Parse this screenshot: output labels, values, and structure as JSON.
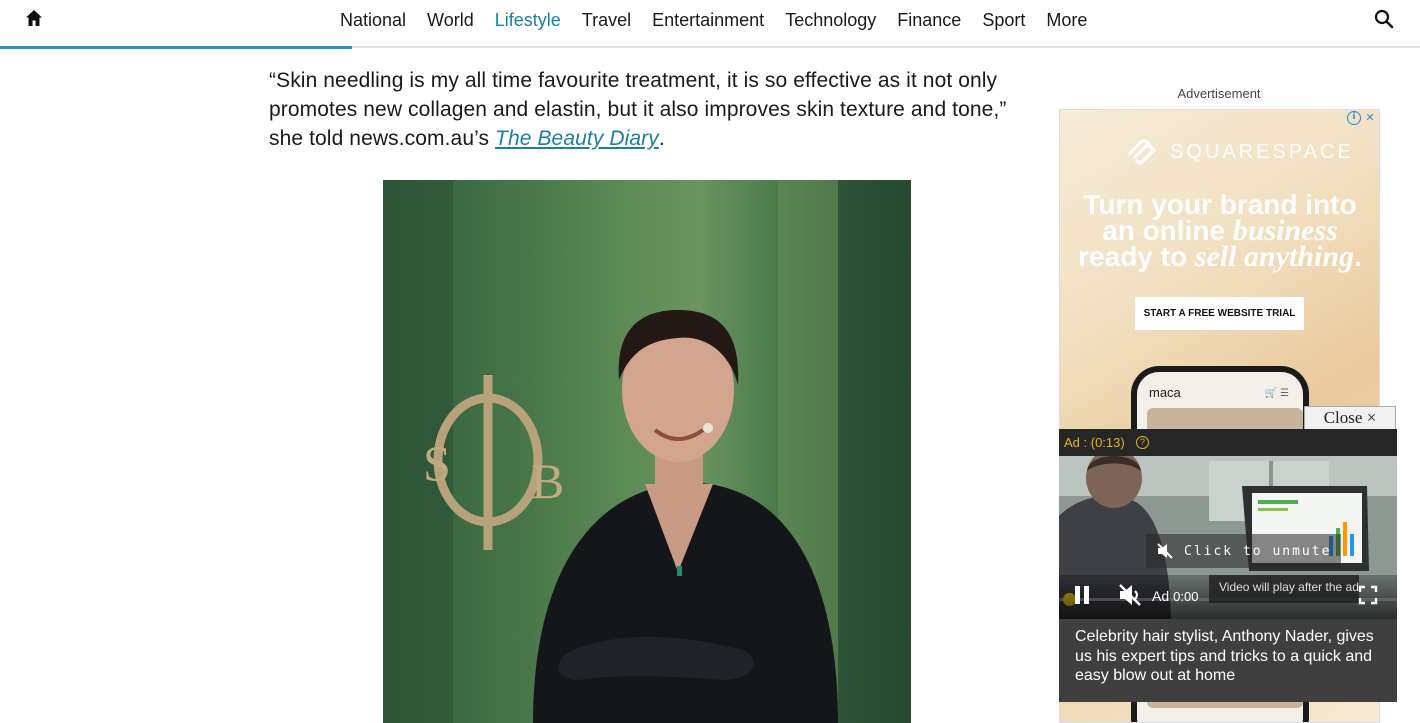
{
  "nav": {
    "items": [
      "National",
      "World",
      "Lifestyle",
      "Travel",
      "Entertainment",
      "Technology",
      "Finance",
      "Sport",
      "More"
    ],
    "active": "Lifestyle",
    "accent_color": "#1a7fa0",
    "home_icon": "home-icon",
    "search_icon": "search-icon"
  },
  "reading_progress": 0.25,
  "article": {
    "quote_text": "“Skin needling is my all time favourite treatment, it is so effective as it not only promotes new collagen and elastin, but it also improves skin texture and tone,” she told news.com.au’s ",
    "link_text": "The Beauty Diary",
    "trailing": "."
  },
  "advert": {
    "label": "Advertisement",
    "brand": "SQUARESPACE",
    "headline_line1": "Turn your brand into",
    "headline_line2_plain": "an online ",
    "headline_line2_italic": "business",
    "headline_line3_plain": "ready to ",
    "headline_line3_italic": "sell anything",
    "headline_line3_end": ".",
    "cta": "START A FREE WEBSITE TRIAL",
    "phone_brand": "maca",
    "adchoices_icons": [
      "info-icon",
      "close-icon"
    ]
  },
  "video_player": {
    "close_label": "Close ×",
    "ad_countdown": "Ad : (0:13)",
    "help_icon": "question-icon",
    "unmute_label": "Click to unmute",
    "time_label": "Ad",
    "time_value": "0:00",
    "note": "Video will play after the ad",
    "progress": 0.0,
    "caption": "Celebrity hair stylist, Anthony Nader, gives us his expert tips and tricks to a quick and easy blow out at home",
    "accent_color": "#f2d21b"
  }
}
